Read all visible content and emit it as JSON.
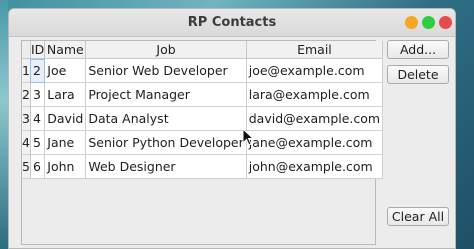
{
  "window": {
    "title": "RP Contacts"
  },
  "table": {
    "headers": [
      "ID",
      "Name",
      "Job",
      "Email"
    ],
    "rows": [
      {
        "row_number": "1",
        "id": "2",
        "name": "Joe",
        "job": "Senior Web Developer",
        "email": "joe@example.com"
      },
      {
        "row_number": "2",
        "id": "3",
        "name": "Lara",
        "job": "Project Manager",
        "email": "lara@example.com"
      },
      {
        "row_number": "3",
        "id": "4",
        "name": "David",
        "job": "Data Analyst",
        "email": "david@example.com"
      },
      {
        "row_number": "4",
        "id": "5",
        "name": "Jane",
        "job": "Senior Python Developer",
        "email": "jane@example.com"
      },
      {
        "row_number": "5",
        "id": "6",
        "name": "John",
        "job": "Web Designer",
        "email": "john@example.com"
      }
    ]
  },
  "buttons": {
    "add": "Add...",
    "delete": "Delete",
    "clear_all": "Clear All"
  },
  "colors": {
    "close": "#e84b4b",
    "minimize": "#f5a623",
    "maximize": "#2ecc40"
  }
}
